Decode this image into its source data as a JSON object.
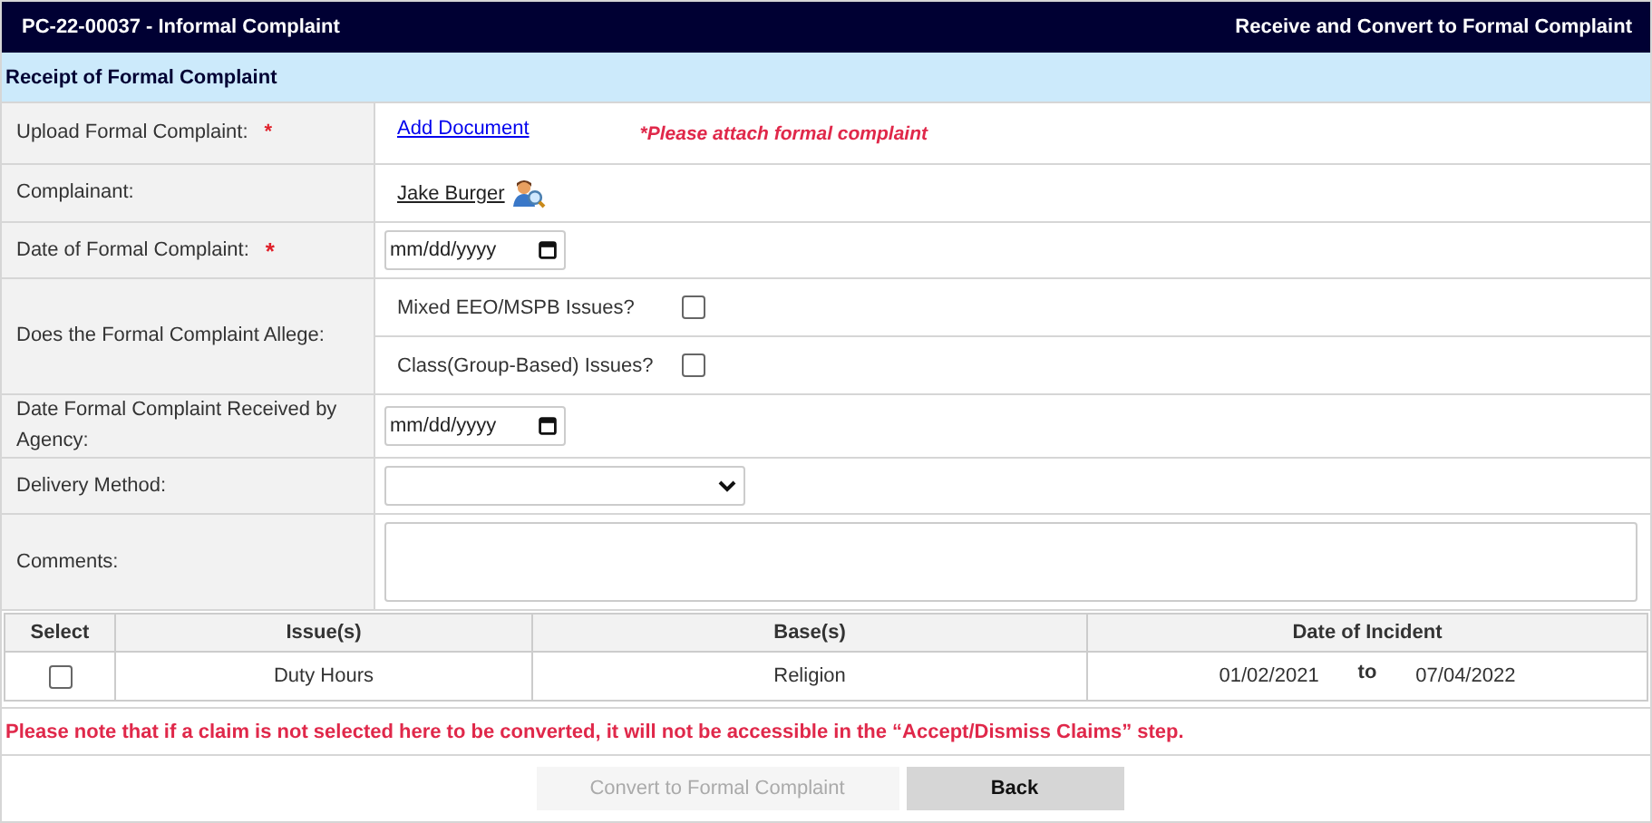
{
  "header": {
    "title": "PC-22-00037 - Informal Complaint",
    "action": "Receive and Convert to Formal Complaint"
  },
  "section": {
    "title": "Receipt of Formal Complaint"
  },
  "fields": [
    {
      "kind": "upload",
      "label": "Upload Formal Complaint:",
      "required_mark": "*",
      "link": "Add Document",
      "note": "*Please attach formal complaint"
    },
    {
      "kind": "person",
      "label": "Complainant:",
      "value": "Jake Burger"
    },
    {
      "kind": "date",
      "label": "Date of Formal Complaint:",
      "required_mark": "*",
      "placeholder": "mm/dd/yyyy"
    },
    {
      "kind": "checks",
      "label": "Does the Formal Complaint Allege:",
      "options": [
        {
          "label": "Mixed EEO/MSPB Issues?",
          "checked": false
        },
        {
          "label": "Class(Group-Based) Issues?",
          "checked": false
        }
      ]
    },
    {
      "kind": "date",
      "label": "Date Formal Complaint Received by Agency:",
      "placeholder": "mm/dd/yyyy"
    },
    {
      "kind": "select",
      "label": "Delivery Method:"
    },
    {
      "kind": "textarea",
      "label": "Comments:"
    }
  ],
  "claims": {
    "columns": [
      "Select",
      "Issue(s)",
      "Base(s)",
      "Date of Incident"
    ],
    "rows": [
      {
        "selected": false,
        "issue": "Duty Hours",
        "base": "Religion",
        "date_from": "01/02/2021",
        "separator": "to",
        "date_to": "07/04/2022"
      }
    ]
  },
  "note": "Please note that if a claim is not selected here to be converted, it will not be accessible in the “Accept/Dismiss Claims” step.",
  "buttons": [
    {
      "label": "Convert to Formal Complaint",
      "disabled": true
    },
    {
      "label": "Back",
      "disabled": false
    }
  ]
}
